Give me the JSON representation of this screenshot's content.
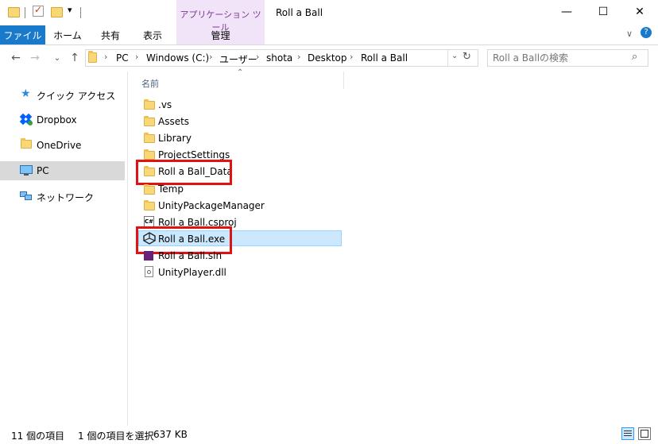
{
  "window": {
    "title": "Roll a Ball",
    "context_tab_group": "アプリケーション ツール",
    "buttons": {
      "minimize": "—",
      "maximize": "☐",
      "close": "✕"
    }
  },
  "ribbon": {
    "tabs": [
      "ファイル",
      "ホーム",
      "共有",
      "表示",
      "管理"
    ]
  },
  "address": {
    "crumbs": [
      "PC",
      "Windows (C:)",
      "ユーザー",
      "shota",
      "Desktop",
      "Roll a Ball"
    ],
    "search_placeholder": "Roll a Ballの検索"
  },
  "nav": {
    "items": [
      {
        "label": "クイック アクセス",
        "icon": "star-icon"
      },
      {
        "label": "Dropbox",
        "icon": "dropbox-icon"
      },
      {
        "label": "OneDrive",
        "icon": "folder-icon"
      },
      {
        "label": "PC",
        "icon": "pc-icon",
        "selected": true
      },
      {
        "label": "ネットワーク",
        "icon": "network-icon"
      }
    ]
  },
  "files": {
    "column_header": "名前",
    "items": [
      {
        "name": ".vs",
        "type": "folder"
      },
      {
        "name": "Assets",
        "type": "folder"
      },
      {
        "name": "Library",
        "type": "folder"
      },
      {
        "name": "ProjectSettings",
        "type": "folder"
      },
      {
        "name": "Roll a Ball_Data",
        "type": "folder",
        "highlighted": true
      },
      {
        "name": "Temp",
        "type": "folder"
      },
      {
        "name": "UnityPackageManager",
        "type": "folder"
      },
      {
        "name": "Roll a Ball.csproj",
        "type": "csproj"
      },
      {
        "name": "Roll a Ball.exe",
        "type": "exe",
        "selected": true,
        "highlighted": true
      },
      {
        "name": "Roll a Ball.sln",
        "type": "sln"
      },
      {
        "name": "UnityPlayer.dll",
        "type": "dll"
      }
    ]
  },
  "status": {
    "item_count": "11 個の項目",
    "selection": "1 個の項目を選択",
    "size": "637 KB"
  },
  "colors": {
    "accent": "#1979ca",
    "context_tab": "#f1e3f8",
    "selection": "#cce8ff",
    "highlight_box": "#e01212"
  }
}
